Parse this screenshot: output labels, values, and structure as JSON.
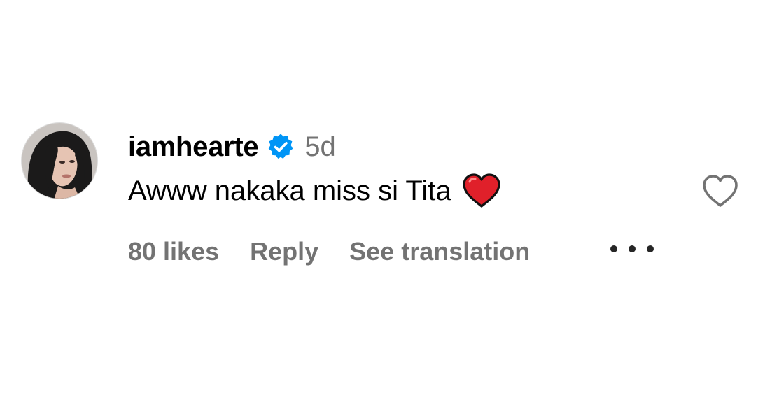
{
  "comment": {
    "username": "iamhearte",
    "verified": true,
    "time_ago": "5d",
    "text": "Awww nakaka miss si Tita",
    "text_emoji": "red-heart-emoji",
    "likes_label": "80 likes",
    "reply_label": "Reply",
    "translation_label": "See translation",
    "like_icon": "heart-outline-icon",
    "more_icon": "more-options-icon"
  },
  "colors": {
    "primary_text": "#000000",
    "secondary_text": "#737373",
    "verified_badge": "#0095f6",
    "emoji_heart": "#e0202a",
    "like_outline": "#737373"
  }
}
